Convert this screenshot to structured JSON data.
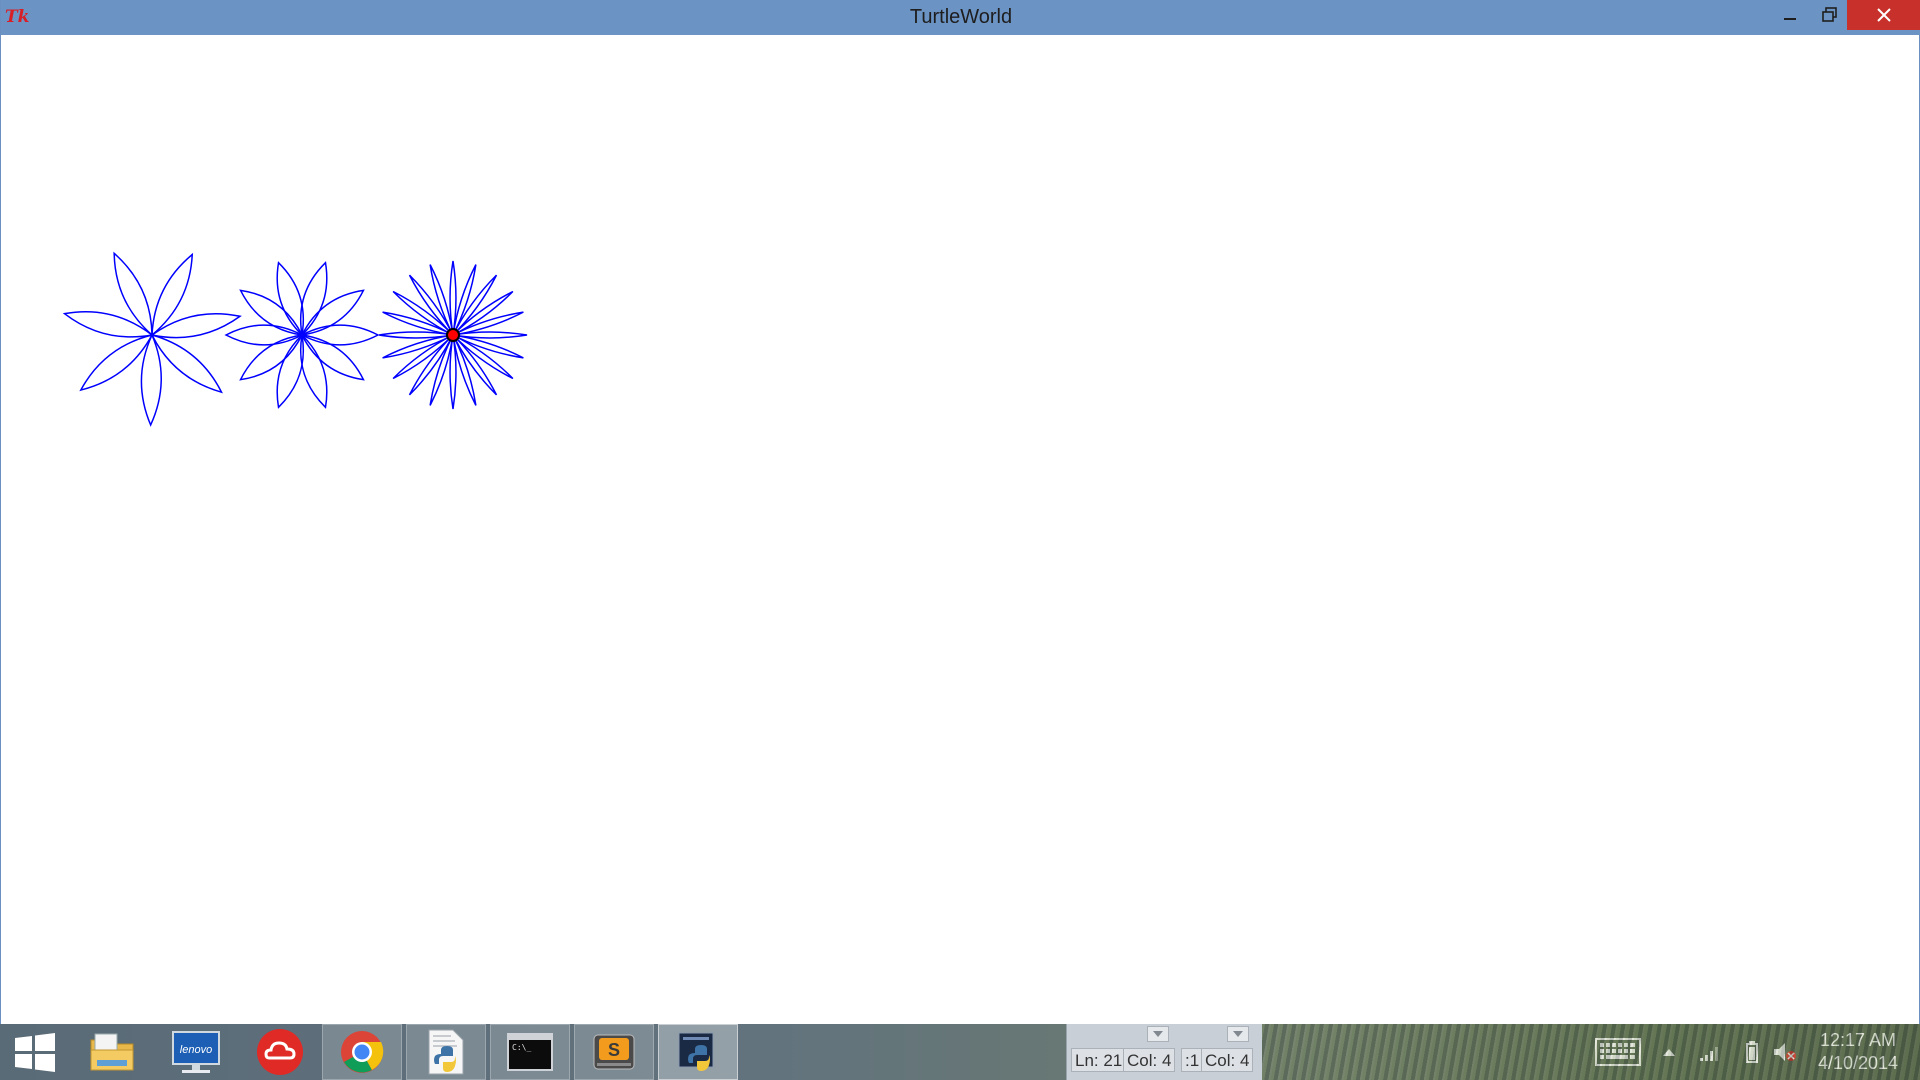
{
  "window": {
    "title": "TurtleWorld",
    "app_icon_text": "Tk",
    "controls": [
      "minimize",
      "restore",
      "close"
    ]
  },
  "canvas": {
    "background": "#ffffff",
    "stroke_color": "#0000ff",
    "turtle_color": "#ff0000",
    "flowers": [
      {
        "name": "flower-7-petals",
        "petals": 7
      },
      {
        "name": "flower-10-petals",
        "petals": 10
      },
      {
        "name": "flower-20-petals",
        "petals": 20
      }
    ]
  },
  "taskbar": {
    "items": [
      {
        "name": "file-explorer",
        "icon": "folder-icon"
      },
      {
        "name": "lenovo",
        "icon": "lenovo-monitor-icon",
        "label": "lenovo"
      },
      {
        "name": "cloud-app",
        "icon": "cloud-icon"
      },
      {
        "name": "chrome",
        "icon": "chrome-icon"
      },
      {
        "name": "python-file",
        "icon": "python-document-icon"
      },
      {
        "name": "command-prompt",
        "icon": "terminal-icon",
        "label": "C:\\_"
      },
      {
        "name": "sublime-text",
        "icon": "sublime-icon",
        "label": "S"
      },
      {
        "name": "python-idle",
        "icon": "python-idle-icon"
      }
    ],
    "peek": {
      "cell1_ln": "Ln: 21",
      "cell1_col": "Col: 4",
      "cell2_ln": ":1",
      "cell2_col": "Col: 4"
    },
    "tray": {
      "icons": [
        "keyboard-icon",
        "show-hidden-icons-icon",
        "signal-icon",
        "battery-icon",
        "volume-muted-icon"
      ],
      "time": "12:17 AM",
      "date": "4/10/2014"
    }
  }
}
